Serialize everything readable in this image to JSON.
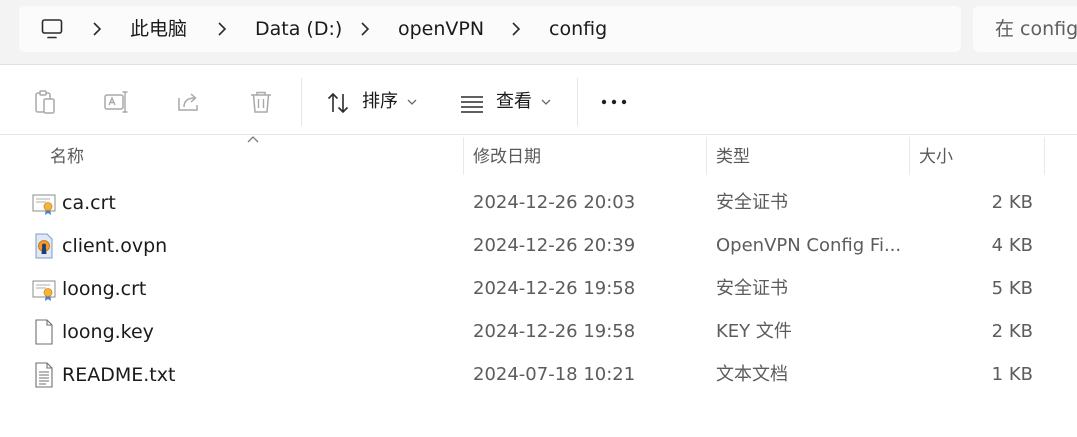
{
  "breadcrumb": {
    "items": [
      "此电脑",
      "Data (D:)",
      "openVPN",
      "config"
    ]
  },
  "search": {
    "placeholder": "在 config"
  },
  "toolbar": {
    "sort_label": "排序",
    "view_label": "查看"
  },
  "columns": {
    "name": "名称",
    "modified": "修改日期",
    "type": "类型",
    "size": "大小"
  },
  "files": [
    {
      "name": "ca.crt",
      "modified": "2024-12-26 20:03",
      "type": "安全证书",
      "size": "2 KB",
      "icon": "certificate-icon"
    },
    {
      "name": "client.ovpn",
      "modified": "2024-12-26 20:39",
      "type": "OpenVPN Config Fi...",
      "size": "4 KB",
      "icon": "openvpn-config-icon"
    },
    {
      "name": "loong.crt",
      "modified": "2024-12-26 19:58",
      "type": "安全证书",
      "size": "5 KB",
      "icon": "certificate-icon"
    },
    {
      "name": "loong.key",
      "modified": "2024-12-26 19:58",
      "type": "KEY 文件",
      "size": "2 KB",
      "icon": "blank-file-icon"
    },
    {
      "name": "README.txt",
      "modified": "2024-07-18 10:21",
      "type": "文本文档",
      "size": "1 KB",
      "icon": "text-file-icon"
    }
  ],
  "colors": {
    "address_band": "#f3f3f3",
    "address_box": "#fbfbfb",
    "disabled_icon": "#9a9a9a",
    "certificate_accent": "#e3a33a"
  }
}
